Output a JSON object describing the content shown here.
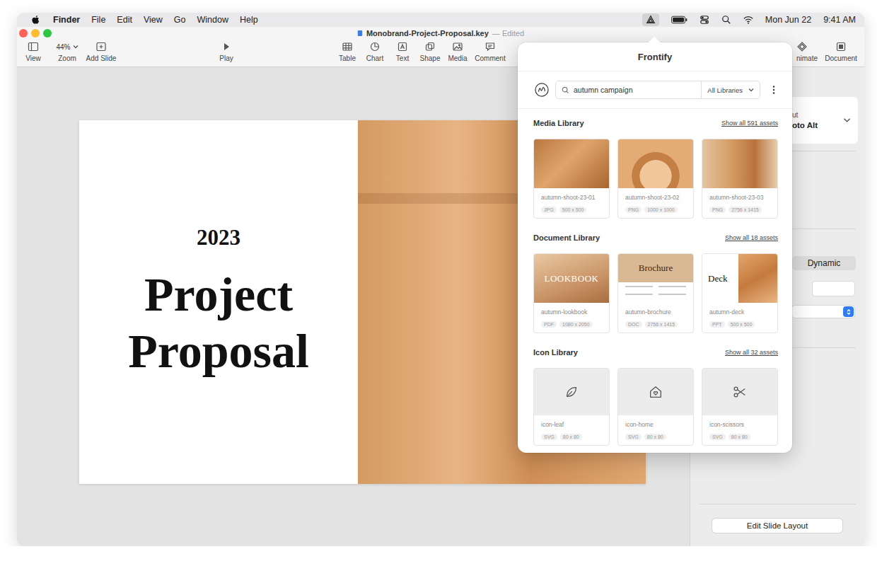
{
  "menu_bar": {
    "app": "Finder",
    "menus": [
      "File",
      "Edit",
      "View",
      "Go",
      "Window",
      "Help"
    ],
    "date": "Mon Jun 22",
    "time": "9:41 AM"
  },
  "window": {
    "title": "Monobrand-Project-Proposal.key",
    "status": "— Edited"
  },
  "toolbar": {
    "zoom": "44%",
    "left": [
      "View",
      "Zoom",
      "Add Slide"
    ],
    "play": "Play",
    "insert": [
      "Table",
      "Chart",
      "Text",
      "Shape",
      "Media",
      "Comment"
    ],
    "right": [
      "nimate",
      "Document"
    ]
  },
  "slide": {
    "year": "2023",
    "title": [
      "Project",
      "Proposal"
    ]
  },
  "inspector": {
    "layout_label": "ut",
    "layout_value": "oto Alt",
    "segment": "Dynamic",
    "button": "Edit Slide Layout"
  },
  "frontify": {
    "title": "Frontify",
    "search": "autumn campaign",
    "scope": "All Libraries",
    "sections": [
      {
        "title": "Media Library",
        "show_all": "Show all 591 assets",
        "assets": [
          {
            "kind": "photo",
            "name": "autumn-shoot-23-01",
            "format": "JPG",
            "size": "500 x 500"
          },
          {
            "kind": "photo",
            "name": "autumn-shoot-23-02",
            "format": "PNG",
            "size": "1000 x 1000"
          },
          {
            "kind": "photo",
            "name": "autumn-shoot-23-03",
            "format": "PNG",
            "size": "2756 x 1415"
          }
        ]
      },
      {
        "title": "Document Library",
        "show_all": "Show all 18 assets",
        "assets": [
          {
            "kind": "cover",
            "thumb_title": "LOOKBOOK",
            "name": "autumn-lookbook",
            "format": "PDF",
            "size": "1080 x 2050"
          },
          {
            "kind": "page",
            "thumb_title": "Brochure",
            "name": "autumn-brochure",
            "format": "DOC",
            "size": "2756 x 1415"
          },
          {
            "kind": "slide",
            "thumb_title": "Deck",
            "name": "autumn-deck",
            "format": "PPT",
            "size": "500 x 500"
          }
        ]
      },
      {
        "title": "Icon Library",
        "show_all": "Show all 32 assets",
        "assets": [
          {
            "kind": "icon",
            "name": "icon-leaf",
            "format": "SVG",
            "size": "80 x 80"
          },
          {
            "kind": "icon",
            "name": "icon-home",
            "format": "SVG",
            "size": "80 x 80"
          },
          {
            "kind": "icon",
            "name": "icon-scissors",
            "format": "SVG",
            "size": "80 x 80"
          }
        ]
      }
    ]
  }
}
